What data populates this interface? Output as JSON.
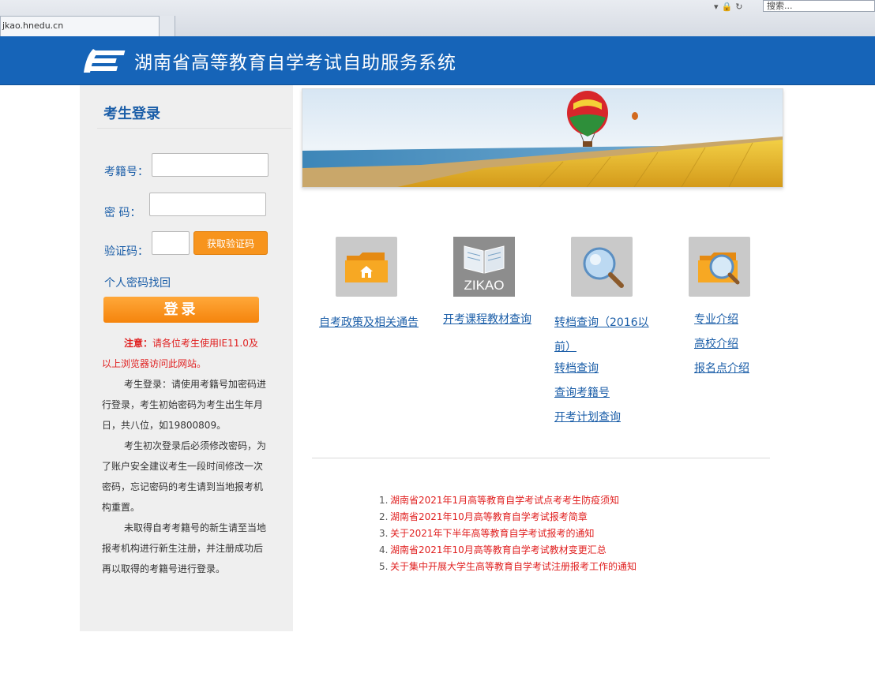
{
  "browser": {
    "tab_title": "jkao.hnedu.cn",
    "search_placeholder": "搜索..."
  },
  "header": {
    "site_title": "湖南省高等教育自学考试自助服务系统",
    "bg_color": "#1664b8"
  },
  "login": {
    "title": "考生登录",
    "exam_no_label": "考籍号：",
    "password_label": "密  码：",
    "captcha_label": "验证码：",
    "get_captcha_label": "获取验证码",
    "find_password": "个人密码找回",
    "login_button": "登录",
    "accent_color": "#f7941d",
    "notice_warn_prefix": "注意：",
    "notice_warn": "请各位考生使用IE11.0及以上浏览器访问此网站。",
    "notice_p1": "考生登录：请使用考籍号加密码进行登录，考生初始密码为考生出生年月日，共八位，如19800809。",
    "notice_p2": "考生初次登录后必须修改密码，为了账户安全建议考生一段时间修改一次密码，忘记密码的考生请到当地报考机构重置。",
    "notice_p3": "未取得自考考籍号的新生请至当地报考机构进行新生注册，并注册成功后再以取得的考籍号进行登录。"
  },
  "quick_links": [
    {
      "icon": "folder-home-icon",
      "links": [
        "自考政策及相关通告"
      ]
    },
    {
      "icon": "zikao-book-icon",
      "icon_text": "ZIKAO",
      "links": [
        "开考课程教材查询"
      ]
    },
    {
      "icon": "magnifier-icon",
      "links": [
        "转档查询（2016以前）",
        "转档查询",
        "查询考籍号",
        "开考计划查询"
      ]
    },
    {
      "icon": "folder-search-icon",
      "links": [
        "专业介绍",
        "高校介绍",
        "报名点介绍"
      ]
    }
  ],
  "news": [
    {
      "num": "1.",
      "text": "湖南省2021年1月高等教育自学考试点考考生防疫须知"
    },
    {
      "num": "2.",
      "text": "湖南省2021年10月高等教育自学考试报考简章"
    },
    {
      "num": "3.",
      "text": "关于2021年下半年高等教育自学考试报考的通知"
    },
    {
      "num": "4.",
      "text": "湖南省2021年10月高等教育自学考试教材变更汇总"
    },
    {
      "num": "5.",
      "text": "关于集中开展大学生高等教育自学考试注册报考工作的通知"
    }
  ]
}
